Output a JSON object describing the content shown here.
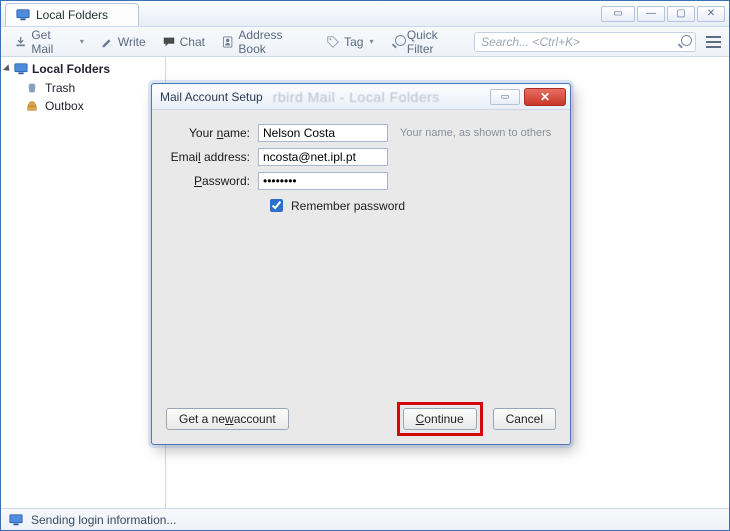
{
  "window": {
    "tab_title": "Local Folders"
  },
  "toolbar": {
    "get_mail": "Get Mail",
    "write": "Write",
    "chat": "Chat",
    "address_book": "Address Book",
    "tag": "Tag",
    "quick_filter": "Quick Filter",
    "search_placeholder": "Search... <Ctrl+K>"
  },
  "sidebar": {
    "root": "Local Folders",
    "items": [
      {
        "label": "Trash"
      },
      {
        "label": "Outbox"
      }
    ]
  },
  "dialog": {
    "title": "Mail Account Setup",
    "blur_text": "rbird Mail  -  Local Folders",
    "labels": {
      "name_pre": "Your ",
      "name_u": "n",
      "name_post": "ame:",
      "email_pre": "Emai",
      "email_u": "l",
      "email_post": " address:",
      "pwd_u": "P",
      "pwd_post": "assword:",
      "remember_pre": "Re",
      "remember_u": "m",
      "remember_post": "ember password"
    },
    "values": {
      "name": "Nelson Costa",
      "email": "ncosta@net.ipl.pt",
      "password": "••••••••",
      "remember_checked": true
    },
    "hint": "Your name, as shown to others",
    "buttons": {
      "get_new_pre": "Get a ne",
      "get_new_u": "w",
      "get_new_post": " account",
      "continue_u": "C",
      "continue_post": "ontinue",
      "cancel": "Cancel"
    }
  },
  "status": {
    "message": "Sending login information..."
  }
}
